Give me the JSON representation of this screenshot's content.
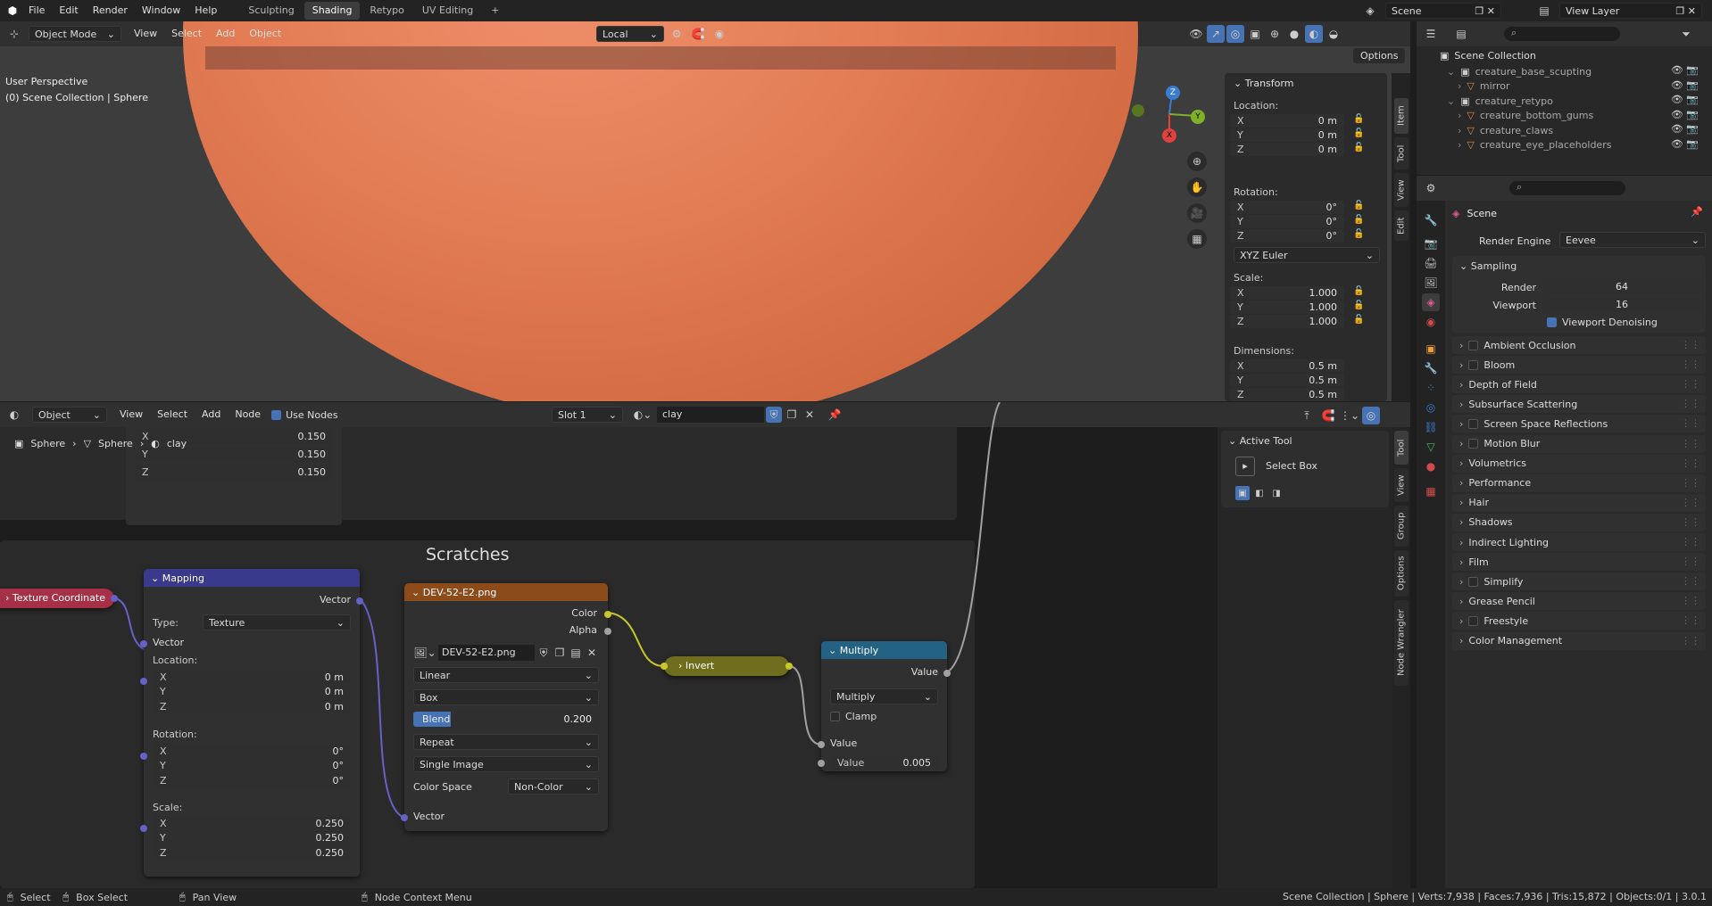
{
  "topbar": {
    "menus": [
      "File",
      "Edit",
      "Render",
      "Window",
      "Help"
    ],
    "workspaces": [
      "Sculpting",
      "Shading",
      "Retypo",
      "UV Editing"
    ],
    "active_workspace": "Shading",
    "add_ws": "+",
    "scene": "Scene",
    "view_layer": "View Layer"
  },
  "viewport": {
    "mode": "Object Mode",
    "menus": [
      "View",
      "Select",
      "Add",
      "Object"
    ],
    "transform_orient": "Local",
    "options": "Options",
    "overlay_line1": "User Perspective",
    "overlay_line2": "(0) Scene Collection | Sphere",
    "tabs": [
      "Item",
      "Tool",
      "View",
      "Edit"
    ],
    "transform": {
      "title": "Transform",
      "location_label": "Location:",
      "location": [
        [
          "X",
          "0 m"
        ],
        [
          "Y",
          "0 m"
        ],
        [
          "Z",
          "0 m"
        ]
      ],
      "rotation_label": "Rotation:",
      "rotation": [
        [
          "X",
          "0°"
        ],
        [
          "Y",
          "0°"
        ],
        [
          "Z",
          "0°"
        ]
      ],
      "rotation_mode": "XYZ Euler",
      "scale_label": "Scale:",
      "scale": [
        [
          "X",
          "1.000"
        ],
        [
          "Y",
          "1.000"
        ],
        [
          "Z",
          "1.000"
        ]
      ],
      "dimensions_label": "Dimensions:",
      "dimensions": [
        [
          "X",
          "0.5 m"
        ],
        [
          "Y",
          "0.5 m"
        ],
        [
          "Z",
          "0.5 m"
        ]
      ]
    },
    "gizmo": {
      "x": "X",
      "y": "Y",
      "z": "Z"
    }
  },
  "outliner": {
    "root": "Scene Collection",
    "items": [
      {
        "name": "creature_base_scupting",
        "level": 1
      },
      {
        "name": "mirror",
        "level": 2
      },
      {
        "name": "creature_retypo",
        "level": 1
      },
      {
        "name": "creature_bottom_gums",
        "level": 2
      },
      {
        "name": "creature_claws",
        "level": 2
      },
      {
        "name": "creature_eye_placeholders",
        "level": 2
      }
    ]
  },
  "properties": {
    "title": "Scene",
    "render_engine_label": "Render Engine",
    "render_engine": "Eevee",
    "sampling": "Sampling",
    "render_label": "Render",
    "render_val": "64",
    "viewport_label": "Viewport",
    "viewport_val": "16",
    "denoise": "Viewport Denoising",
    "panels": [
      {
        "label": "Ambient Occlusion",
        "chk": true
      },
      {
        "label": "Bloom",
        "chk": true
      },
      {
        "label": "Depth of Field",
        "chk": false
      },
      {
        "label": "Subsurface Scattering",
        "chk": false
      },
      {
        "label": "Screen Space Reflections",
        "chk": true
      },
      {
        "label": "Motion Blur",
        "chk": true
      },
      {
        "label": "Volumetrics",
        "chk": false
      },
      {
        "label": "Performance",
        "chk": false
      },
      {
        "label": "Hair",
        "chk": false
      },
      {
        "label": "Shadows",
        "chk": false
      },
      {
        "label": "Indirect Lighting",
        "chk": false
      },
      {
        "label": "Film",
        "chk": false
      },
      {
        "label": "Simplify",
        "chk": true
      },
      {
        "label": "Grease Pencil",
        "chk": false
      },
      {
        "label": "Freestyle",
        "chk": true
      },
      {
        "label": "Color Management",
        "chk": false
      }
    ]
  },
  "node_editor": {
    "editor_type": "Object",
    "menus": [
      "View",
      "Select",
      "Add",
      "Node"
    ],
    "use_nodes": "Use Nodes",
    "slot": "Slot 1",
    "material": "clay",
    "breadcrumb": [
      "Sphere",
      "Sphere",
      "clay"
    ],
    "tabs": [
      "Tool",
      "View",
      "Group",
      "Options",
      "Node Wrangler"
    ],
    "active_tool": {
      "title": "Active Tool",
      "name": "Select Box"
    },
    "partial_node": {
      "x": "X",
      "x_val": "0.150",
      "y": "Y",
      "y_val": "0.150",
      "z": "Z",
      "z_val": "0.150"
    },
    "frame_label": "Scratches",
    "texcoord": {
      "title": "Texture Coordinate"
    },
    "mapping": {
      "title": "Mapping",
      "out": "Vector",
      "type_label": "Type:",
      "type": "Texture",
      "in_vector": "Vector",
      "location_label": "Location:",
      "location": [
        [
          "X",
          "0 m"
        ],
        [
          "Y",
          "0 m"
        ],
        [
          "Z",
          "0 m"
        ]
      ],
      "rotation_label": "Rotation:",
      "rotation": [
        [
          "X",
          "0°"
        ],
        [
          "Y",
          "0°"
        ],
        [
          "Z",
          "0°"
        ]
      ],
      "scale_label": "Scale:",
      "scale": [
        [
          "X",
          "0.250"
        ],
        [
          "Y",
          "0.250"
        ],
        [
          "Z",
          "0.250"
        ]
      ]
    },
    "image": {
      "title": "DEV-52-E2.png",
      "out_color": "Color",
      "out_alpha": "Alpha",
      "image_name": "DEV-52-E2.png",
      "interp": "Linear",
      "proj": "Box",
      "blend_label": "Blend",
      "blend": "0.200",
      "blend_fraction": 0.2,
      "ext": "Repeat",
      "source": "Single Image",
      "cs_label": "Color Space",
      "cs": "Non-Color",
      "in_vector": "Vector"
    },
    "invert": {
      "title": "Invert"
    },
    "multiply": {
      "title": "Multiply",
      "out": "Value",
      "op": "Multiply",
      "clamp": "Clamp",
      "in_value": "Value",
      "value_label": "Value",
      "value": "0.005"
    }
  },
  "statusbar": {
    "select": "Select",
    "box_select": "Box Select",
    "pan": "Pan View",
    "ctx": "Node Context Menu",
    "stats": "Scene Collection | Sphere | Verts:7,938 | Faces:7,936 | Tris:15,872 | Objects:0/1 | 3.0.1"
  },
  "colors": {
    "accent": "#4772b3",
    "clay": "#e07a52",
    "mapping_head": "#3a3a8c",
    "image_head": "#8c4b1a",
    "invert_head": "#6e6e1e",
    "multiply_head": "#246283",
    "texcoord_head": "#a63045"
  }
}
